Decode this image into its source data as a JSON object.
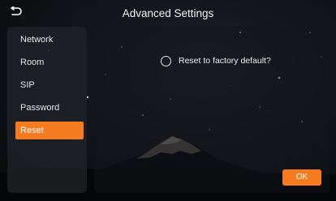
{
  "header": {
    "title": "Advanced Settings",
    "back_icon": "back-arrow-icon"
  },
  "sidebar": {
    "items": [
      {
        "label": "Network",
        "active": false
      },
      {
        "label": "Room",
        "active": false
      },
      {
        "label": "SIP",
        "active": false
      },
      {
        "label": "Password",
        "active": false
      },
      {
        "label": "Reset",
        "active": true
      }
    ]
  },
  "main": {
    "option_label": "Reset to factory default?",
    "option_checked": false,
    "ok_label": "OK"
  },
  "colors": {
    "accent": "#f47b20"
  }
}
